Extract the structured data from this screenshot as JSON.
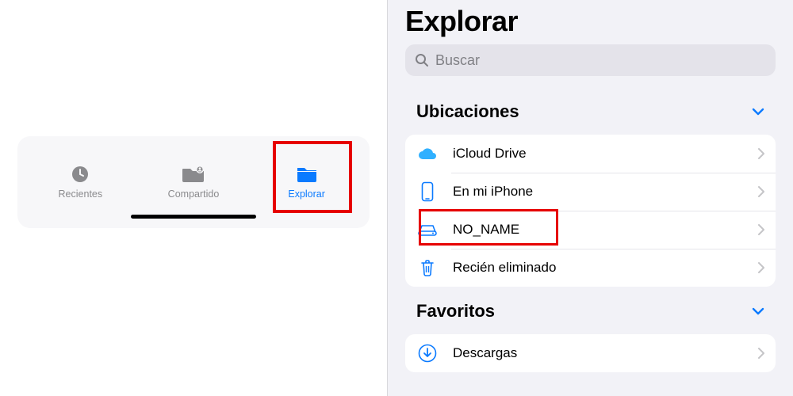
{
  "left": {
    "tabs": [
      {
        "label": "Recientes"
      },
      {
        "label": "Compartido"
      },
      {
        "label": "Explorar"
      }
    ],
    "active_index": 2
  },
  "right": {
    "title": "Explorar",
    "search_placeholder": "Buscar",
    "sections": [
      {
        "header": "Ubicaciones",
        "items": [
          {
            "label": "iCloud Drive"
          },
          {
            "label": "En mi iPhone"
          },
          {
            "label": "NO_NAME"
          },
          {
            "label": "Recién eliminado"
          }
        ]
      },
      {
        "header": "Favoritos",
        "items": [
          {
            "label": "Descargas"
          }
        ]
      }
    ]
  },
  "highlight": {
    "tab_index": 2,
    "location_row_index": 2
  }
}
